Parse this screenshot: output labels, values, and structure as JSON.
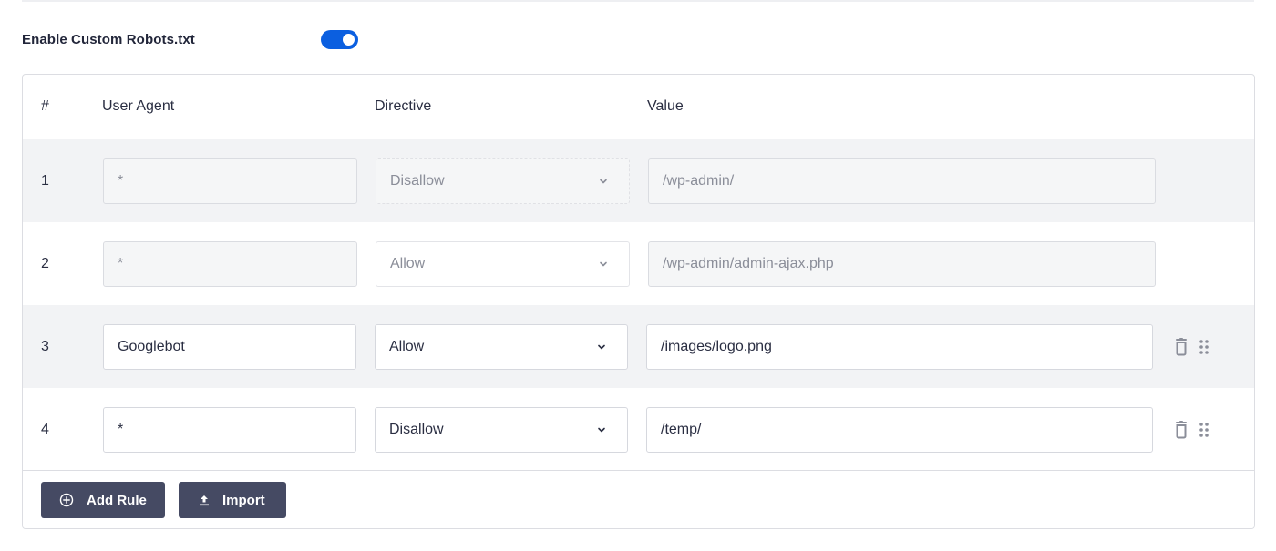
{
  "setting": {
    "label": "Enable Custom Robots.txt",
    "toggle_on": true,
    "accent_color": "#0b5fe0"
  },
  "table": {
    "headers": {
      "number": "#",
      "user_agent": "User Agent",
      "directive": "Directive",
      "value": "Value"
    },
    "rows": [
      {
        "number": "1",
        "user_agent": "*",
        "directive": "Disallow",
        "value": "/wp-admin/",
        "editable": false
      },
      {
        "number": "2",
        "user_agent": "*",
        "directive": "Allow",
        "value": "/wp-admin/admin-ajax.php",
        "editable": false
      },
      {
        "number": "3",
        "user_agent": "Googlebot",
        "directive": "Allow",
        "value": "/images/logo.png",
        "editable": true
      },
      {
        "number": "4",
        "user_agent": "*",
        "directive": "Disallow",
        "value": "/temp/",
        "editable": true
      }
    ],
    "row_icons": [
      "trash-icon",
      "drag-handle-icon"
    ]
  },
  "footer": {
    "add_rule_label": "Add Rule",
    "add_rule_icon": "plus-circle-icon",
    "import_label": "Import",
    "import_icon": "upload-icon",
    "button_color": "#454a63"
  }
}
